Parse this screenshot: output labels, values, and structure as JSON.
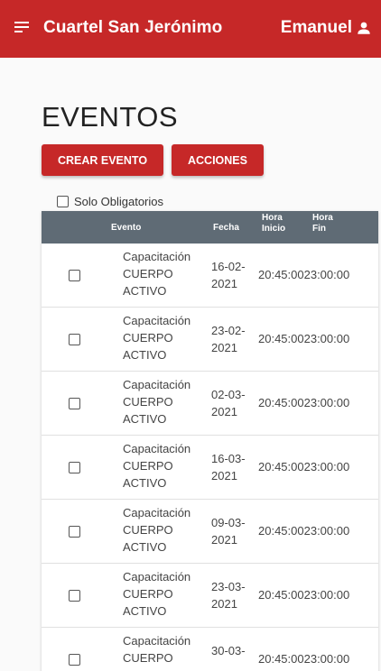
{
  "header": {
    "title": "Cuartel San Jerónimo",
    "user_name": "Emanuel"
  },
  "page": {
    "title": "EVENTOS",
    "create_button": "CREAR EVENTO",
    "actions_button": "ACCIONES",
    "filter_label": "Solo Obligatorios"
  },
  "table": {
    "columns": {
      "evento": "Evento",
      "fecha": "Fecha",
      "hora_inicio": "Hora Inicio",
      "hora_fin": "Hora Fin"
    },
    "rows": [
      {
        "evento": "Capacitación CUERPO ACTIVO",
        "fecha": "16-02-2021",
        "hora_inicio": "20:45:00",
        "hora_fin": "23:00:00"
      },
      {
        "evento": "Capacitación CUERPO ACTIVO",
        "fecha": "23-02-2021",
        "hora_inicio": "20:45:00",
        "hora_fin": "23:00:00"
      },
      {
        "evento": "Capacitación CUERPO ACTIVO",
        "fecha": "02-03-2021",
        "hora_inicio": "20:45:00",
        "hora_fin": "23:00:00"
      },
      {
        "evento": "Capacitación CUERPO ACTIVO",
        "fecha": "16-03-2021",
        "hora_inicio": "20:45:00",
        "hora_fin": "23:00:00"
      },
      {
        "evento": "Capacitación CUERPO ACTIVO",
        "fecha": "09-03-2021",
        "hora_inicio": "20:45:00",
        "hora_fin": "23:00:00"
      },
      {
        "evento": "Capacitación CUERPO ACTIVO",
        "fecha": "23-03-2021",
        "hora_inicio": "20:45:00",
        "hora_fin": "23:00:00"
      },
      {
        "evento": "Capacitación CUERPO",
        "fecha": "30-03-",
        "hora_inicio": "20:45:00",
        "hora_fin": "23:00:00"
      }
    ]
  },
  "icons": {
    "menu": "menu-icon",
    "user": "user-icon"
  },
  "colors": {
    "primary": "#c62828",
    "table_header": "#5f6b75"
  }
}
